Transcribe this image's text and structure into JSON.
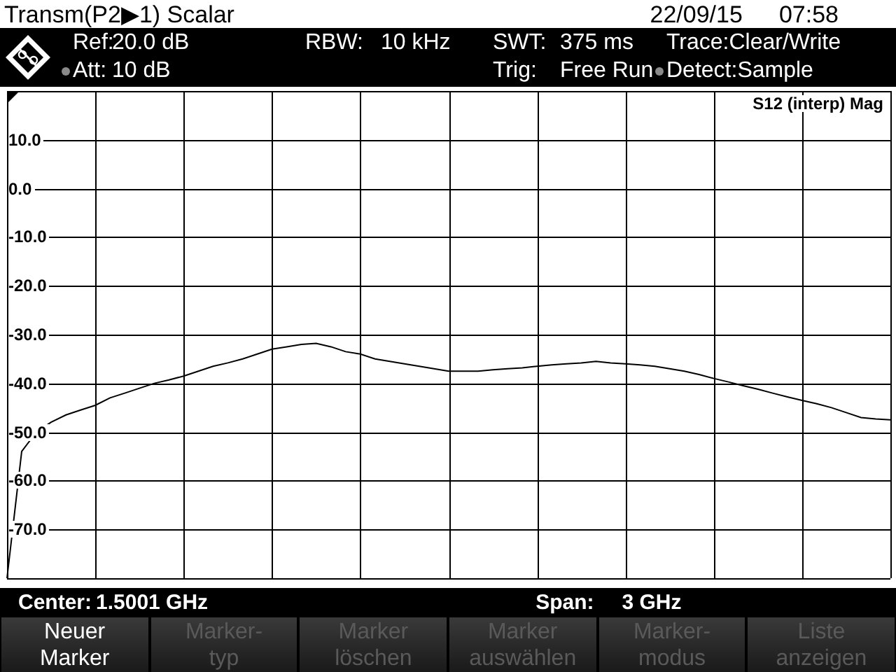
{
  "title_bar": {
    "title": "Transm(P2▶1) Scalar",
    "date": "22/09/15",
    "time": "07:58"
  },
  "header": {
    "rows": [
      [
        {
          "label": "Ref:",
          "value": "20.0 dB",
          "marked": false
        },
        {
          "label": "RBW:",
          "value": "10 kHz",
          "marked": false
        },
        {
          "label": "SWT:",
          "value": "375 ms",
          "marked": false
        },
        {
          "label": "Trace:",
          "value": "Clear/Write",
          "marked": false
        }
      ],
      [
        {
          "label": "Att:",
          "value": "10 dB",
          "marked": true
        },
        "",
        {
          "label": "Trig:",
          "value": "Free Run",
          "marked": false
        },
        {
          "label": "Detect:",
          "value": "Sample",
          "marked": true
        }
      ]
    ]
  },
  "plot": {
    "chart_data": {
      "type": "line",
      "grid": true,
      "ylim": [
        -80,
        20
      ],
      "yticks": [
        {
          "value": 10,
          "label": "10.0"
        },
        {
          "value": 0,
          "label": "0.0"
        },
        {
          "value": -10,
          "label": "-10.0"
        },
        {
          "value": -20,
          "label": "-20.0"
        },
        {
          "value": -30,
          "label": "-30.0"
        },
        {
          "value": -40,
          "label": "-40.0"
        },
        {
          "value": -50,
          "label": "-50.0"
        },
        {
          "value": -60,
          "label": "-60.0"
        },
        {
          "value": -70,
          "label": "-70.0"
        }
      ],
      "categories": [
        null,
        null,
        null,
        null,
        null,
        null,
        null,
        null,
        null,
        null,
        null,
        null,
        null,
        null,
        null,
        null,
        null,
        null,
        null,
        null,
        null,
        null,
        null,
        null,
        null,
        null,
        null,
        null,
        null,
        null,
        null,
        null,
        null,
        null,
        null,
        null,
        null,
        null,
        null,
        null,
        null,
        null,
        null,
        null,
        null,
        null,
        null,
        null,
        null,
        null,
        null,
        null,
        null,
        null,
        null,
        null,
        null,
        null,
        null,
        null,
        null
      ],
      "series": [
        {
          "name": "S12 (interp) Mag",
          "color": "#000000",
          "values": [
            -80,
            -54,
            -50,
            -48,
            -46.5,
            -45.5,
            -44.5,
            -43,
            -42,
            -41,
            -40,
            -39.3,
            -38.5,
            -37.5,
            -36.5,
            -35.8,
            -35,
            -34,
            -33,
            -32.5,
            -32,
            -31.8,
            -32.5,
            -33.5,
            -34,
            -35,
            -35.5,
            -36,
            -36.5,
            -37,
            -37.5,
            -37.5,
            -37.5,
            -37.2,
            -37,
            -36.8,
            -36.5,
            -36.2,
            -36,
            -35.8,
            -35.5,
            -35.8,
            -36,
            -36.2,
            -36.5,
            -37,
            -37.5,
            -38.2,
            -39,
            -39.7,
            -40.5,
            -41.2,
            -42,
            -42.8,
            -43.5,
            -44.2,
            -45,
            -46,
            -47,
            -47.3,
            -47.5
          ]
        }
      ]
    }
  },
  "status_bar": {
    "center_label": "Center:",
    "center_value": "1.5001 GHz",
    "span_label": "Span:",
    "span_value": "3 GHz"
  },
  "softkeys": [
    {
      "lines": [
        "Neuer",
        "Marker"
      ],
      "disabled": false
    },
    {
      "lines": [
        "Marker-",
        "typ"
      ],
      "disabled": true
    },
    {
      "lines": [
        "Marker",
        "löschen"
      ],
      "disabled": true
    },
    {
      "lines": [
        "Marker",
        "auswählen"
      ],
      "disabled": true
    },
    {
      "lines": [
        "Marker-",
        "modus"
      ],
      "disabled": true
    },
    {
      "lines": [
        "Liste",
        "anzeigen"
      ],
      "disabled": true
    }
  ]
}
